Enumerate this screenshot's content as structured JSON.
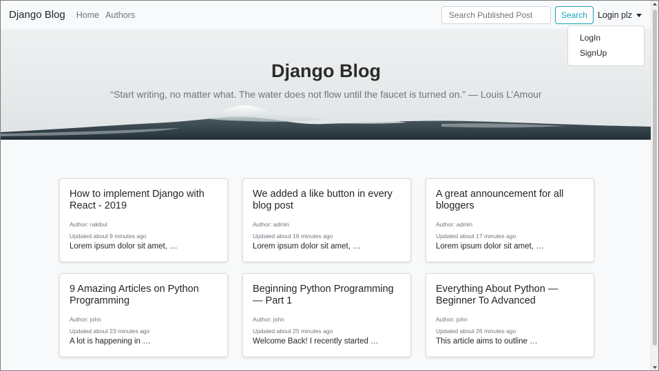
{
  "navbar": {
    "brand": "Django Blog",
    "links": [
      "Home",
      "Authors"
    ],
    "search_placeholder": "Search Published Post",
    "search_button": "Search",
    "login_label": "Login plz"
  },
  "dropdown": {
    "items": [
      "LogIn",
      "SignUp"
    ]
  },
  "hero": {
    "title": "Django Blog",
    "quote": "“Start writing, no matter what. The water does not flow until the faucet is turned on.” — Louis L’Amour"
  },
  "posts": [
    {
      "title": "How to implement Django with React - 2019",
      "author": "Author: rakibul",
      "updated": "Updated about 9 minutes ago",
      "excerpt": "Lorem ipsum dolor sit amet, …"
    },
    {
      "title": "We added a like button in every blog post",
      "author": "Author: admin",
      "updated": "Updated about 16 minutes ago",
      "excerpt": "Lorem ipsum dolor sit amet, …"
    },
    {
      "title": "A great announcement for all bloggers",
      "author": "Author: admin",
      "updated": "Updated about 17 minutes ago",
      "excerpt": "Lorem ipsum dolor sit amet, …"
    },
    {
      "title": "9 Amazing Articles on Python Programming",
      "author": "Author: john",
      "updated": "Updated about 23 minutes ago",
      "excerpt": "A lot is happening in …"
    },
    {
      "title": "Beginning Python Programming — Part 1",
      "author": "Author: john",
      "updated": "Updated about 25 minutes ago",
      "excerpt": "Welcome Back! I recently started …"
    },
    {
      "title": "Everything About Python — Beginner To Advanced",
      "author": "Author: john",
      "updated": "Updated about 26 minutes ago",
      "excerpt": "This article aims to outline …"
    }
  ],
  "colors": {
    "accent": "#17a2b8",
    "muted": "#6c757d",
    "navbar_bg": "#f8f9fa"
  }
}
